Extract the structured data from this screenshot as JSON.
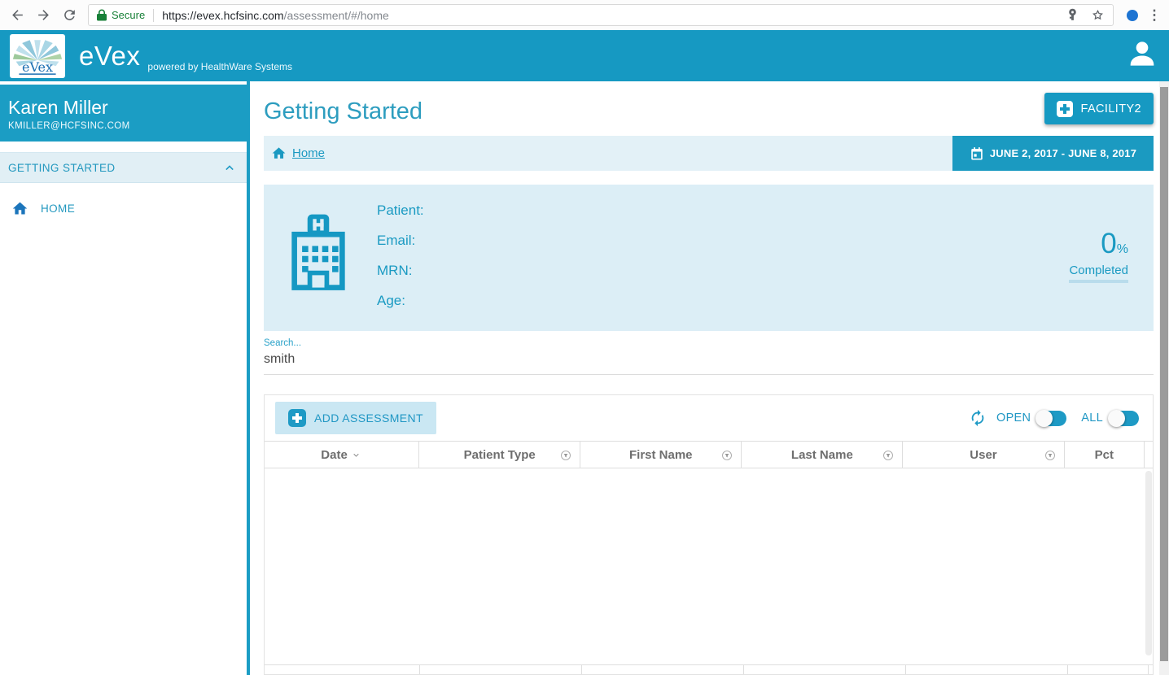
{
  "browser": {
    "secure_label": "Secure",
    "url_host": "https://evex.hcfsinc.com",
    "url_path": "/assessment/#/home",
    "menu_glyph": "⋮"
  },
  "header": {
    "logo_text": "eVex",
    "app_name": "eVex",
    "tagline": "powered by HealthWare Systems"
  },
  "sidebar": {
    "user_name": "Karen Miller",
    "user_email": "KMILLER@HCFSINC.COM",
    "section_label": "GETTING STARTED",
    "items": [
      {
        "label": "HOME"
      }
    ]
  },
  "main": {
    "page_title": "Getting Started",
    "facility_button_label": "FACILITY2",
    "breadcrumb": {
      "home_label": "Home"
    },
    "date_range": "JUNE 2, 2017 - JUNE 8, 2017",
    "patient_card": {
      "labels": [
        "Patient:",
        "Email:",
        "MRN:",
        "Age:"
      ],
      "percent_value": "0",
      "percent_sign": "%",
      "completed_label": "Completed"
    },
    "search": {
      "label": "Search...",
      "value": "smith"
    },
    "table": {
      "add_button_label": "ADD ASSESSMENT",
      "open_label": "OPEN",
      "all_label": "ALL",
      "columns": [
        {
          "label": "Date",
          "sort": "desc",
          "filter": false
        },
        {
          "label": "Patient Type",
          "filter": true
        },
        {
          "label": "First Name",
          "filter": true
        },
        {
          "label": "Last Name",
          "filter": true
        },
        {
          "label": "User",
          "filter": true
        },
        {
          "label": "Pct",
          "filter": false
        }
      ],
      "rows": []
    }
  },
  "colors": {
    "accent_teal": "#1699c2",
    "teal_text": "#2097c4",
    "light_panel": "#dceef6",
    "breadcrumb_bg": "#e3f1f7",
    "secure_green": "#188038",
    "avatar_blue": "#1d74d2",
    "header_text_gray": "#6e6e6e"
  },
  "icons": {
    "browser": [
      "back-arrow",
      "forward-arrow",
      "reload",
      "lock",
      "key",
      "star",
      "avatar-ring",
      "menu-dots"
    ],
    "app": [
      "evex-logo",
      "person",
      "home",
      "chevron-up",
      "plus",
      "calendar",
      "hospital",
      "refresh",
      "filter",
      "sort-down"
    ]
  }
}
